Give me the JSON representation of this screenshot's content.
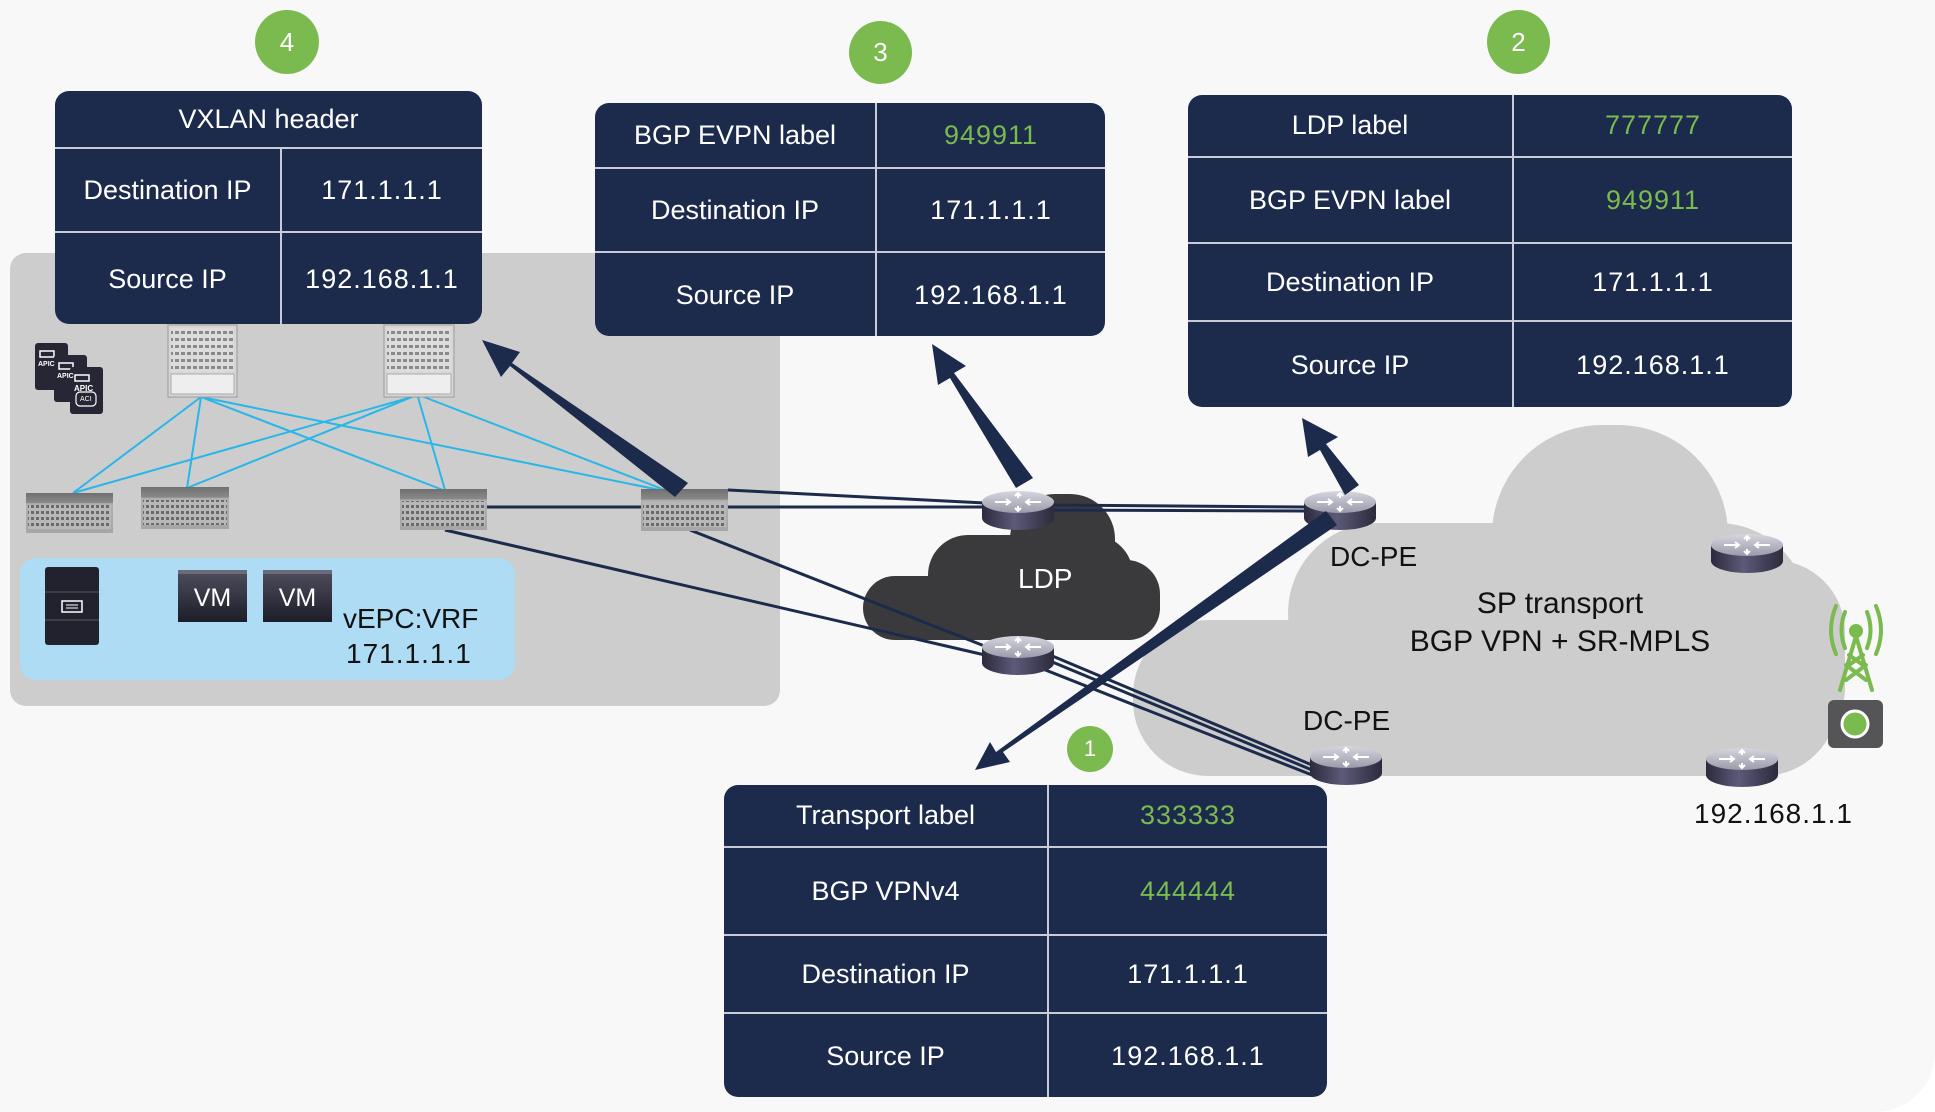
{
  "colors": {
    "table_bg": "#1c2a4c",
    "badge_green": "#7aba4f",
    "label_green": "#7aba4f",
    "arrow_navy": "#1c2a4c",
    "fabric_link_blue": "#29b6e8",
    "ldp_cloud": "#3a3a3c",
    "sp_cloud": "#cdcdcd",
    "vm_zone": "#aedcf5"
  },
  "steps": [
    {
      "number": "4",
      "table": {
        "header": "VXLAN header",
        "rows": [
          {
            "key": "Destination IP",
            "value": "171.1.1.1",
            "highlight": false
          },
          {
            "key": "Source IP",
            "value": "192.168.1.1",
            "highlight": false
          }
        ]
      }
    },
    {
      "number": "3",
      "table": {
        "rows": [
          {
            "key": "BGP EVPN label",
            "value": "949911",
            "highlight": true
          },
          {
            "key": "Destination IP",
            "value": "171.1.1.1",
            "highlight": false
          },
          {
            "key": "Source IP",
            "value": "192.168.1.1",
            "highlight": false
          }
        ]
      }
    },
    {
      "number": "2",
      "table": {
        "rows": [
          {
            "key": "LDP label",
            "value": "777777",
            "highlight": true
          },
          {
            "key": "BGP EVPN label",
            "value": "949911",
            "highlight": true
          },
          {
            "key": "Destination IP",
            "value": "171.1.1.1",
            "highlight": false
          },
          {
            "key": "Source IP",
            "value": "192.168.1.1",
            "highlight": false
          }
        ]
      }
    },
    {
      "number": "1",
      "table": {
        "rows": [
          {
            "key": "Transport label",
            "value": "333333",
            "highlight": true
          },
          {
            "key": "BGP VPNv4",
            "value": "444444",
            "highlight": true
          },
          {
            "key": "Destination IP",
            "value": "171.1.1.1",
            "highlight": false
          },
          {
            "key": "Source IP",
            "value": "192.168.1.1",
            "highlight": false
          }
        ]
      }
    }
  ],
  "fabric": {
    "apic_label": "APIC",
    "aci_label": "ACI",
    "vm_labels": [
      "VM",
      "VM"
    ],
    "vrf_name": "vEPC:VRF",
    "vrf_ip": "171.1.1.1"
  },
  "ldp_cloud": {
    "label": "LDP"
  },
  "sp_cloud": {
    "line1": "SP transport",
    "line2": "BGP VPN + SR-MPLS"
  },
  "pe_labels": [
    "DC-PE",
    "DC-PE"
  ],
  "endpoint": {
    "ip": "192.168.1.1",
    "icon": "cell-tower-icon"
  }
}
